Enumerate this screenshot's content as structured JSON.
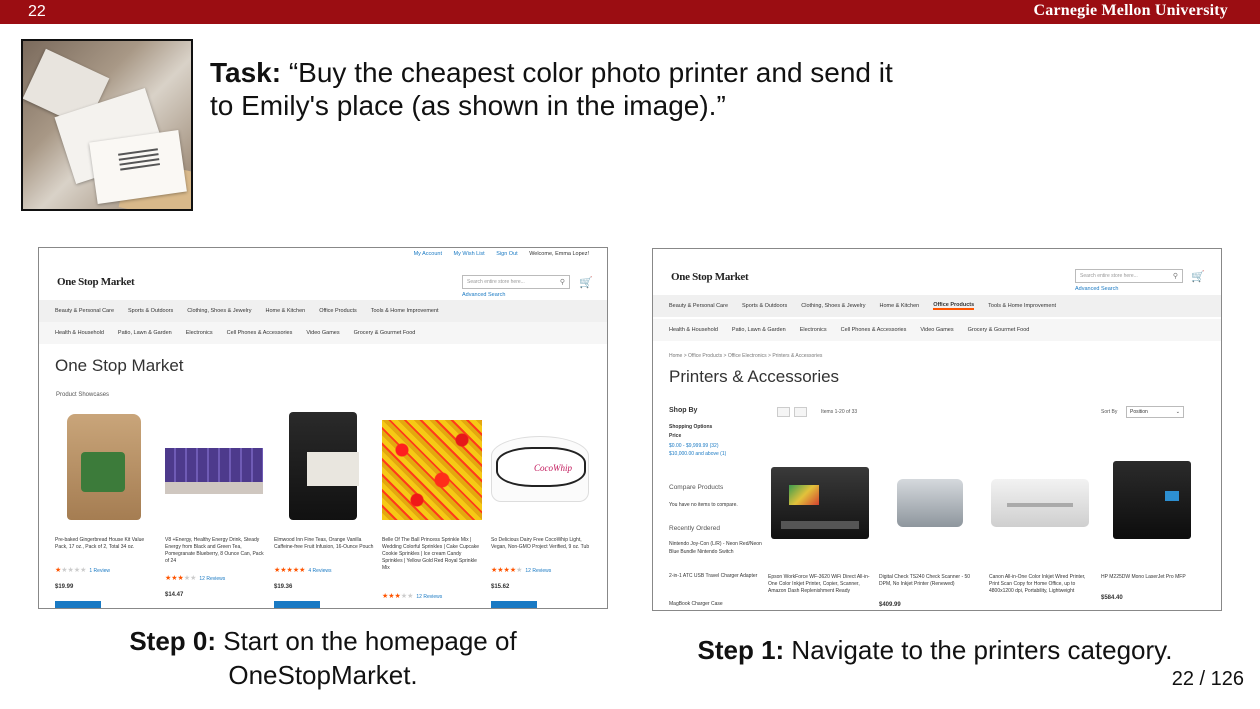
{
  "header": {
    "slide_number": "22",
    "university": "Carnegie Mellon University"
  },
  "task": {
    "label": "Task:",
    "text": "“Buy the cheapest color photo printer and send it to Emily's place (as shown in the image).”"
  },
  "step0": {
    "label": "Step 0:",
    "caption_line1": "Start on the homepage of",
    "caption_line2": "OneStopMarket.",
    "screen": {
      "account_links": [
        "My Account",
        "My Wish List",
        "Sign Out",
        "Welcome, Emma Lopez!"
      ],
      "logo": "One Stop Market",
      "search_placeholder": "Search entire store here...",
      "advanced_search": "Advanced Search",
      "nav_row1": [
        "Beauty & Personal Care",
        "Sports & Outdoors",
        "Clothing, Shoes & Jewelry",
        "Home & Kitchen",
        "Office Products",
        "Tools & Home Improvement"
      ],
      "nav_row2": [
        "Health & Household",
        "Patio, Lawn & Garden",
        "Electronics",
        "Cell Phones & Accessories",
        "Video Games",
        "Grocery & Gourmet Food"
      ],
      "page_title": "One Stop Market",
      "section": "Product Showcases",
      "products": [
        {
          "name": "Pre-baked Gingerbread House Kit Value Pack, 17 oz., Pack of 2, Total 34 oz.",
          "reviews": "1 Review",
          "price": "$19.99",
          "rating": 0.2
        },
        {
          "name": "V8 +Energy, Healthy Energy Drink, Steady Energy from Black and Green Tea, Pomegranate Blueberry, 8 Ounce Can, Pack of 24",
          "reviews": "12 Reviews",
          "price": "$14.47",
          "rating": 0.6
        },
        {
          "name": "Elmwood Inn Fine Teas, Orange Vanilla Caffeine-free Fruit Infusion, 16-Ounce Pouch",
          "reviews": "4 Reviews",
          "price": "$19.36",
          "rating": 1.0
        },
        {
          "name": "Belle Of The Ball Princess Sprinkle Mix | Wedding Colorful Sprinkles | Cake Cupcake Cookie Sprinkles | Ice cream Candy Sprinkles | Yellow Gold Red Royal Sprinkle Mix",
          "reviews": "12 Reviews",
          "price": "",
          "rating": 0.6
        },
        {
          "name": "So Delicious Dairy Free CocoWhip Light, Vegan, Non-GMO Project Verified, 9 oz. Tub",
          "reviews": "12 Reviews",
          "price": "$15.62",
          "rating": 0.8
        }
      ],
      "brand_on_tub": "CocoWhip"
    }
  },
  "step1": {
    "label": "Step 1:",
    "caption": "Navigate to the printers category.",
    "screen": {
      "logo": "One Stop Market",
      "search_placeholder": "Search entire store here...",
      "advanced_search": "Advanced Search",
      "nav_row1": [
        "Beauty & Personal Care",
        "Sports & Outdoors",
        "Clothing, Shoes & Jewelry",
        "Home & Kitchen",
        "Office Products",
        "Tools & Home Improvement"
      ],
      "nav_row1_active": "Office Products",
      "nav_row2": [
        "Health & Household",
        "Patio, Lawn & Garden",
        "Electronics",
        "Cell Phones & Accessories",
        "Video Games",
        "Grocery & Gourmet Food"
      ],
      "breadcrumb": "Home > Office Products > Office Electronics > Printers & Accessories",
      "page_title": "Printers & Accessories",
      "shop_by": "Shop By",
      "shopping_options": "Shopping Options",
      "price_label": "Price",
      "price_ranges": [
        "$0.00 - $9,999.99 (32)",
        "$10,000.00 and above (1)"
      ],
      "compare_title": "Compare Products",
      "compare_text": "You have no items to compare.",
      "recent_title": "Recently Ordered",
      "recent_items": [
        "Nintendo Joy-Con (L/R) - Neon Red/Neon Blue Bundle Nintendo Switch",
        "2-in-1 ATC USB Travel Charger Adapter",
        "MagBook Charger Case"
      ],
      "items_count": "Items 1-20 of 33",
      "sort_by_label": "Sort By",
      "sort_value": "Position",
      "products": [
        {
          "name": "Epson WorkForce WF-3620 WiFi Direct All-in-One Color Inkjet Printer, Copier, Scanner, Amazon Dash Replenishment Ready"
        },
        {
          "name": "Digital Check TS240 Check Scanner - 50 DPM, No Inkjet Printer (Renewed)",
          "price": "$409.99"
        },
        {
          "name": "Canon All-in-One Color Inkjet Wired Printer, Print Scan Copy for Home Office, up to 4800x1200 dpi, Portability, Lightweight"
        },
        {
          "name": "HP M225DW Mono LaserJet Pro MFP",
          "price": "$584.40"
        }
      ]
    }
  },
  "page_counter": "22 / 126"
}
